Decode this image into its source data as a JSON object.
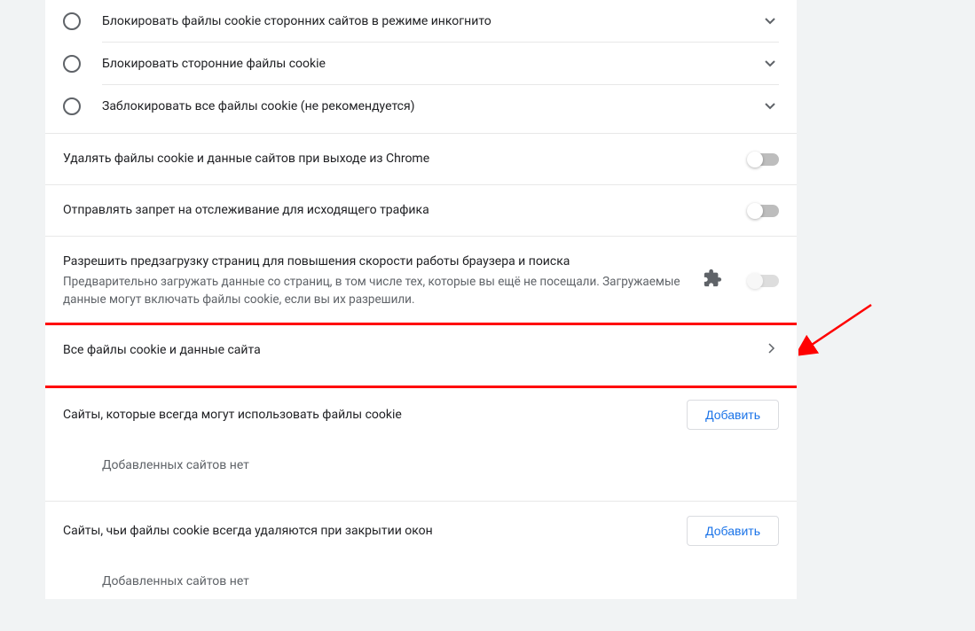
{
  "radios": [
    {
      "label": "Блокировать файлы cookie сторонних сайтов в режиме инкогнито"
    },
    {
      "label": "Блокировать сторонние файлы cookie"
    },
    {
      "label": "Заблокировать все файлы cookie (не рекомендуется)"
    }
  ],
  "toggles": {
    "clear_on_exit": {
      "title": "Удалять файлы cookie и данные сайтов при выходе из Chrome"
    },
    "do_not_track": {
      "title": "Отправлять запрет на отслеживание для исходящего трафика"
    },
    "preload": {
      "title": "Разрешить предзагрузку страниц для повышения скорости работы браузера и поиска",
      "subtitle": "Предварительно загружать данные со страниц, в том числе тех, которые вы ещё не посещали. Загружаемые данные могут включать файлы cookie, если вы их разрешили."
    }
  },
  "site_data_link": "Все файлы cookie и данные сайта",
  "sections": {
    "always_allow": {
      "title": "Сайты, которые всегда могут использовать файлы cookie",
      "add": "Добавить",
      "empty": "Добавленных сайтов нет"
    },
    "clear_on_close": {
      "title": "Сайты, чьи файлы cookie всегда удаляются при закрытии окон",
      "add": "Добавить",
      "empty": "Добавленных сайтов нет"
    }
  }
}
